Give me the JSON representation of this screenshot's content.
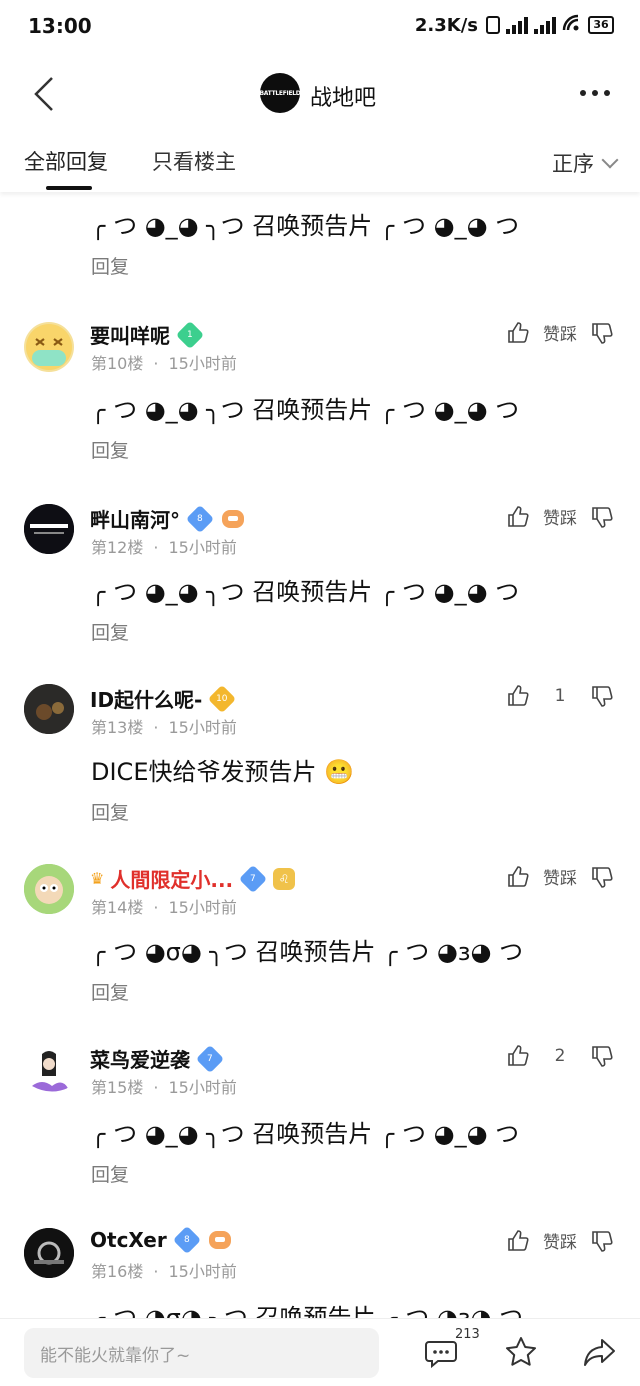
{
  "status_bar": {
    "time": "13:00",
    "net_speed": "2.3K/s",
    "battery": "36"
  },
  "header": {
    "forum_logo_text": "BATTLEFIELD",
    "forum_name": "战地吧"
  },
  "tabs": {
    "all_replies": "全部回复",
    "owner_only": "只看楼主",
    "sort_label": "正序"
  },
  "vote_label": "赞踩",
  "reply_label": "回复",
  "top_partial": {
    "content": "╭ つ ◕_◕ ╮つ 召唤预告片 ╭ つ ◕_◕ つ"
  },
  "comments": [
    {
      "name": "要叫咩呢",
      "badge": "1",
      "floor": "第10楼",
      "time": "15小时前",
      "content": "╭ つ ◕_◕ ╮つ 召唤预告片 ╭ つ ◕_◕ つ",
      "likes": "赞踩"
    },
    {
      "name": "畔山南河°",
      "badge": "8",
      "floor": "第12楼",
      "time": "15小时前",
      "content": "╭ つ ◕_◕ ╮つ 召唤预告片 ╭ つ ◕_◕ つ",
      "likes": "赞踩"
    },
    {
      "name": "ID起什么呢-",
      "badge": "10",
      "floor": "第13楼",
      "time": "15小时前",
      "content": "DICE快给爷发预告片 😬",
      "likes": "1"
    },
    {
      "name": "人間限定小...",
      "badge": "7",
      "floor": "第14楼",
      "time": "15小时前",
      "content": "╭ つ ◕σ◕ ╮つ 召唤预告片 ╭ つ ◕з◕ つ",
      "likes": "赞踩"
    },
    {
      "name": "菜鸟爱逆袭",
      "badge": "7",
      "floor": "第15楼",
      "time": "15小时前",
      "content": "╭ つ ◕_◕ ╮つ 召唤预告片 ╭ つ ◕_◕ つ",
      "likes": "2"
    },
    {
      "name": "OtcXer",
      "badge": "8",
      "floor": "第16楼",
      "time": "15小时前",
      "content": "╭ つ ◕σ◕ ╮つ 召唤预告片 ╭ つ ◕з◕ つ",
      "likes": "赞踩"
    }
  ],
  "bottom_bar": {
    "input_placeholder": "能不能火就靠你了~",
    "comment_count": "213"
  },
  "colors": {
    "red_name": "#e0302b",
    "badge_green": "#3ccf8e",
    "badge_blue": "#5b9cf5",
    "badge_gold": "#f3b72e"
  }
}
